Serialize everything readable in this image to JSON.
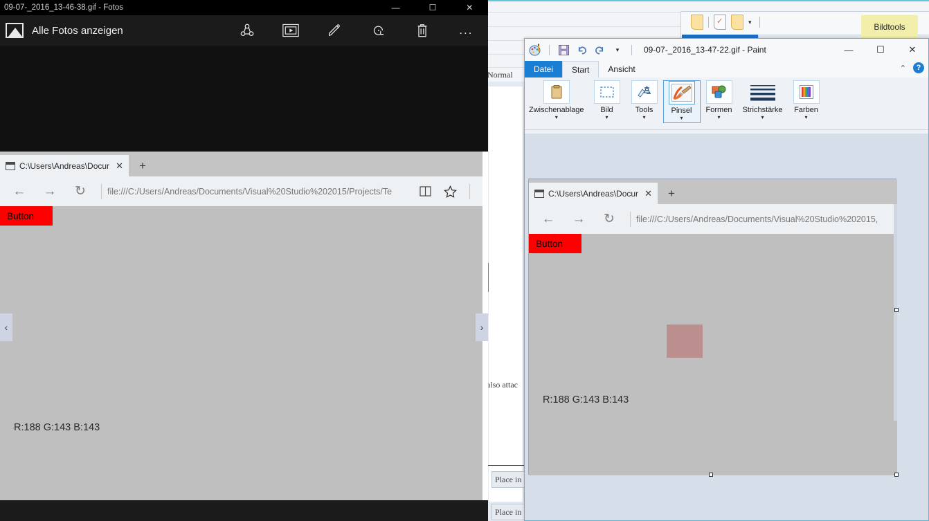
{
  "photos_window": {
    "title": "09-07-_2016_13-46-38.gif - Fotos",
    "back_label": "Alle Fotos anzeigen",
    "back_icon": "picture-icon",
    "toolbar_icons": [
      {
        "name": "share-icon",
        "glyph": "share"
      },
      {
        "name": "slideshow-icon",
        "glyph": "slideshow"
      },
      {
        "name": "edit-pencil-icon",
        "glyph": "pencil"
      },
      {
        "name": "rotate-icon",
        "glyph": "rotate"
      },
      {
        "name": "delete-trash-icon",
        "glyph": "trash"
      },
      {
        "name": "more-options-icon",
        "glyph": "..."
      }
    ],
    "window_controls": {
      "minimize": "—",
      "maximize": "☐",
      "close": "✕"
    },
    "nav_prev": "‹",
    "nav_next": "›"
  },
  "edge_left": {
    "tab_title": "C:\\Users\\Andreas\\Docur",
    "tab_close": "✕",
    "new_tab": "+",
    "back": "←",
    "forward": "→",
    "refresh": "↻",
    "url": "file:///C:/Users/Andreas/Documents/Visual%20Studio%202015/Projects/Te",
    "reading_view_icon": "book-icon",
    "favorite_icon": "star-icon",
    "page": {
      "button_label": "Button",
      "rgb_text": "R:188 G:143 B:143"
    }
  },
  "paint_window": {
    "title": "09-07-_2016_13-47-22.gif - Paint",
    "app_icon": "paint-palette-icon",
    "quick_access": [
      {
        "name": "save-icon",
        "glyph": "save"
      },
      {
        "name": "undo-icon",
        "glyph": "↶"
      },
      {
        "name": "redo-icon",
        "glyph": "↷"
      },
      {
        "name": "customize-qat-icon",
        "glyph": "▾"
      }
    ],
    "window_controls": {
      "minimize": "—",
      "maximize": "☐",
      "close": "✕"
    },
    "tabs": [
      {
        "label": "Datei",
        "state": "file"
      },
      {
        "label": "Start",
        "state": "active"
      },
      {
        "label": "Ansicht",
        "state": "normal"
      }
    ],
    "collapse_ribbon": "⌃",
    "help": "?",
    "ribbon_groups": [
      {
        "label": "Zwischenablage",
        "icon": "clipboard-icon",
        "caret": "▾",
        "selected": false
      },
      {
        "label": "Bild",
        "icon": "select-rectangle-icon",
        "caret": "▾",
        "selected": false
      },
      {
        "label": "Tools",
        "icon": "tools-icon",
        "caret": "▾",
        "selected": false
      },
      {
        "label": "Pinsel",
        "icon": "brush-icon",
        "caret": "▾",
        "selected": true
      },
      {
        "label": "Formen",
        "icon": "shapes-icon",
        "caret": "▾",
        "selected": false
      },
      {
        "label": "Strichstärke",
        "icon": "line-thickness-icon",
        "caret": "▾",
        "selected": false
      },
      {
        "label": "Farben",
        "icon": "colors-icon",
        "caret": "▾",
        "selected": false
      }
    ]
  },
  "edge_in_paint": {
    "tab_title": "C:\\Users\\Andreas\\Docur",
    "tab_close": "✕",
    "new_tab": "+",
    "back": "←",
    "forward": "→",
    "refresh": "↻",
    "url": "file:///C:/Users/Andreas/Documents/Visual%20Studio%202015,",
    "page": {
      "button_label": "Button",
      "rgb_text": "R:188 G:143 B:143",
      "square_color": "#bc8f8f"
    }
  },
  "background_window": {
    "style_label": "Normal",
    "body_text": "also attac",
    "placeholder_1": "Place in",
    "placeholder_2": "Place in",
    "image_tools_tab": "Bildtools",
    "toolbar_icons": [
      {
        "name": "document-icon"
      },
      {
        "name": "checked-document-icon"
      },
      {
        "name": "document-icon"
      },
      {
        "name": "dropdown-caret-icon",
        "glyph": "▾"
      }
    ]
  },
  "colors": {
    "red_button": "#ff0000",
    "rosy_brown": "#bc8f8f",
    "paint_accent": "#1a7fd4",
    "bildtools_tab": "#f2efaa"
  }
}
